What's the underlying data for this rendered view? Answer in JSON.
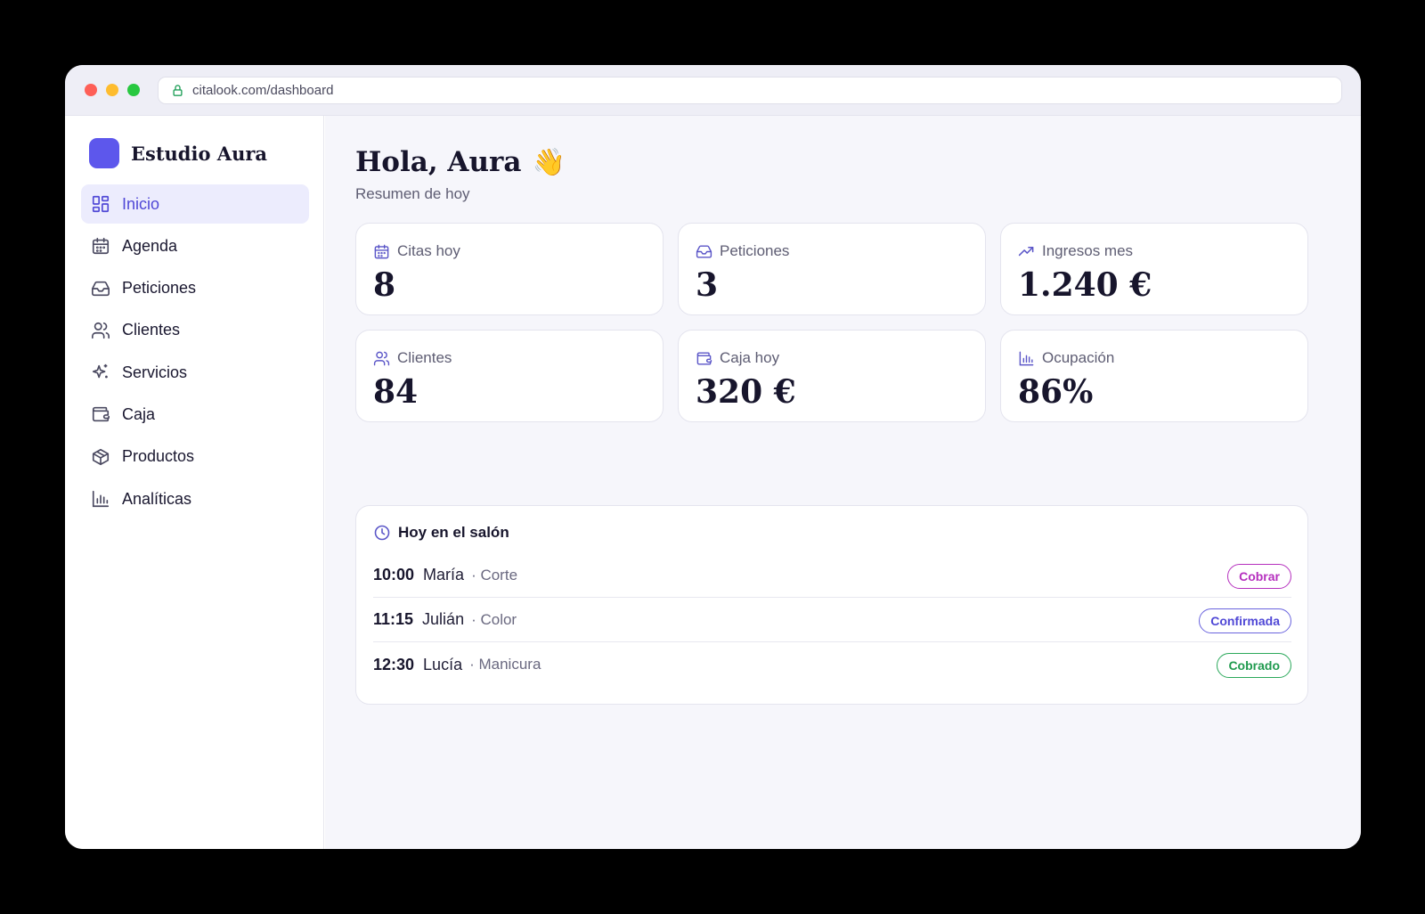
{
  "browser": {
    "url": "citalook.com/dashboard"
  },
  "sidebar": {
    "brand_name": "Estudio Aura",
    "brand_color": "#5d57ec",
    "items": [
      {
        "label": "Inicio",
        "icon": "grid-icon",
        "active": true
      },
      {
        "label": "Agenda",
        "icon": "calendar-icon"
      },
      {
        "label": "Peticiones",
        "icon": "inbox-icon"
      },
      {
        "label": "Clientes",
        "icon": "users-icon"
      },
      {
        "label": "Servicios",
        "icon": "sparkles-icon"
      },
      {
        "label": "Caja",
        "icon": "wallet-icon"
      },
      {
        "label": "Productos",
        "icon": "box-icon"
      },
      {
        "label": "Analíticas",
        "icon": "bar-chart-icon"
      }
    ]
  },
  "header": {
    "greeting": "Hola, Aura",
    "emoji": "👋",
    "subtitle": "Resumen de hoy"
  },
  "stats": [
    {
      "label": "Citas hoy",
      "value": "8",
      "icon": "calendar-icon"
    },
    {
      "label": "Peticiones",
      "value": "3",
      "icon": "inbox-icon"
    },
    {
      "label": "Ingresos mes",
      "value": "1.240 €",
      "icon": "trending-up-icon"
    },
    {
      "label": "Clientes",
      "value": "84",
      "icon": "users-icon"
    },
    {
      "label": "Caja hoy",
      "value": "320 €",
      "icon": "wallet-icon"
    },
    {
      "label": "Ocupación",
      "value": "86%",
      "icon": "bar-chart-icon"
    }
  ],
  "today": {
    "title": "Hoy en el salón",
    "icon": "clock-icon",
    "appointments": [
      {
        "time": "10:00",
        "client": "María",
        "service": "· Corte",
        "status": "Cobrar",
        "status_color": "#b52fbe"
      },
      {
        "time": "11:15",
        "client": "Julián",
        "service": "· Color",
        "status": "Confirmada",
        "status_color": "#5048d6"
      },
      {
        "time": "12:30",
        "client": "Lucía",
        "service": "· Manicura",
        "status": "Cobrado",
        "status_color": "#1f9a4e"
      }
    ]
  },
  "colors": {
    "accent": "#5048d6",
    "icon": "#5b56c8"
  }
}
